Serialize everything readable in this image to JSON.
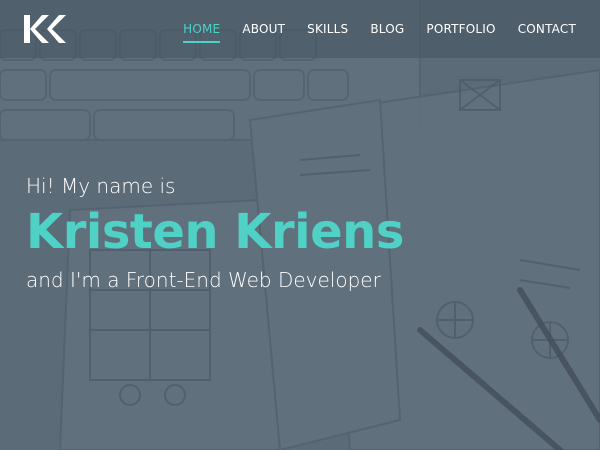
{
  "brand": {
    "logo_text": "KK"
  },
  "nav": {
    "items": [
      {
        "label": "HOME",
        "active": true
      },
      {
        "label": "ABOUT",
        "active": false
      },
      {
        "label": "SKILLS",
        "active": false
      },
      {
        "label": "BLOG",
        "active": false
      },
      {
        "label": "PORTFOLIO",
        "active": false
      },
      {
        "label": "CONTACT",
        "active": false
      }
    ]
  },
  "hero": {
    "intro": "Hi! My name is",
    "name": "Kristen Kriens",
    "role": "and I'm a Front-End Web Developer"
  },
  "colors": {
    "accent": "#4fd1c5",
    "overlay": "#5c6b78",
    "text": "#ffffff"
  }
}
